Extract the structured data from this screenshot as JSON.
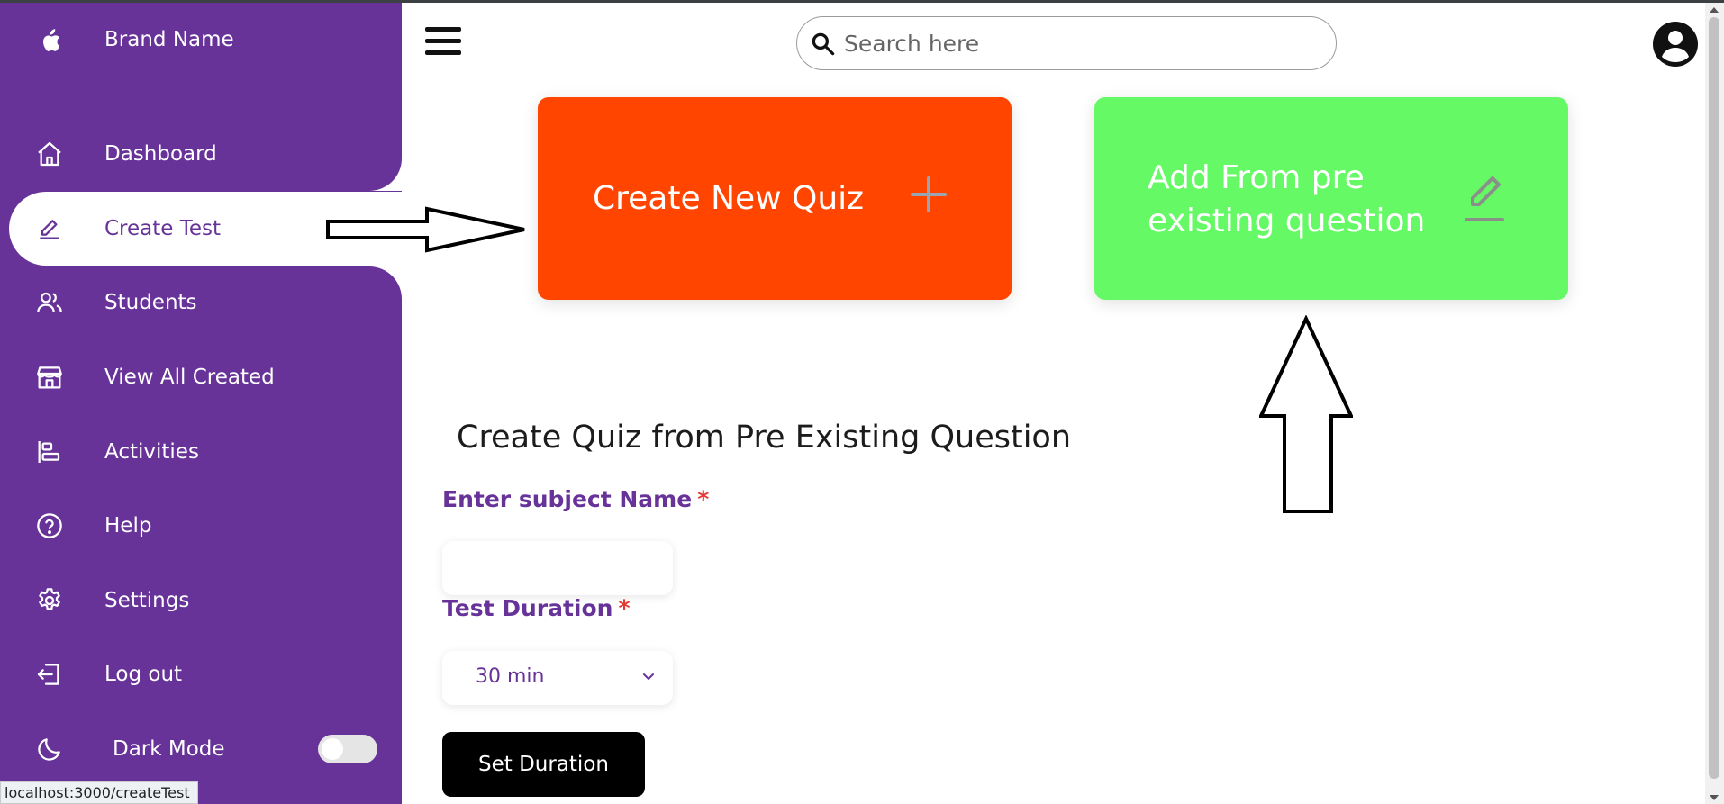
{
  "brand": {
    "name": "Brand Name",
    "logo_icon": "apple-icon"
  },
  "sidebar": {
    "items": [
      {
        "label": "Dashboard",
        "icon": "home-icon"
      },
      {
        "label": "Create Test",
        "icon": "pencil-icon",
        "active": true
      },
      {
        "label": "Students",
        "icon": "users-icon"
      },
      {
        "label": "View All Created",
        "icon": "store-icon"
      },
      {
        "label": "Activities",
        "icon": "bars-icon"
      },
      {
        "label": "Help",
        "icon": "help-circle-icon"
      },
      {
        "label": "Settings",
        "icon": "gear-icon"
      },
      {
        "label": "Log out",
        "icon": "logout-icon"
      }
    ],
    "dark_mode": {
      "label": "Dark Mode",
      "icon": "moon-icon",
      "enabled": false
    }
  },
  "header": {
    "search_placeholder": "Search here",
    "avatar_icon": "user-circle-icon",
    "menu_icon": "hamburger-icon"
  },
  "cards": [
    {
      "title": "Create New Quiz",
      "icon": "plus-icon",
      "color": "#ff4500"
    },
    {
      "title": "Add From pre existing question",
      "icon": "edit-icon",
      "color": "#66f966"
    }
  ],
  "form": {
    "title": "Create Quiz from Pre Existing Question",
    "subject_label": "Enter subject Name",
    "subject_value": "",
    "duration_label": "Test Duration",
    "required_mark": "*",
    "duration_value": "30 min",
    "set_button": "Set Duration"
  },
  "status_url": "localhost:3000/createTest",
  "colors": {
    "sidebar": "#673399",
    "accent_text": "#673399",
    "required": "#e53935"
  }
}
